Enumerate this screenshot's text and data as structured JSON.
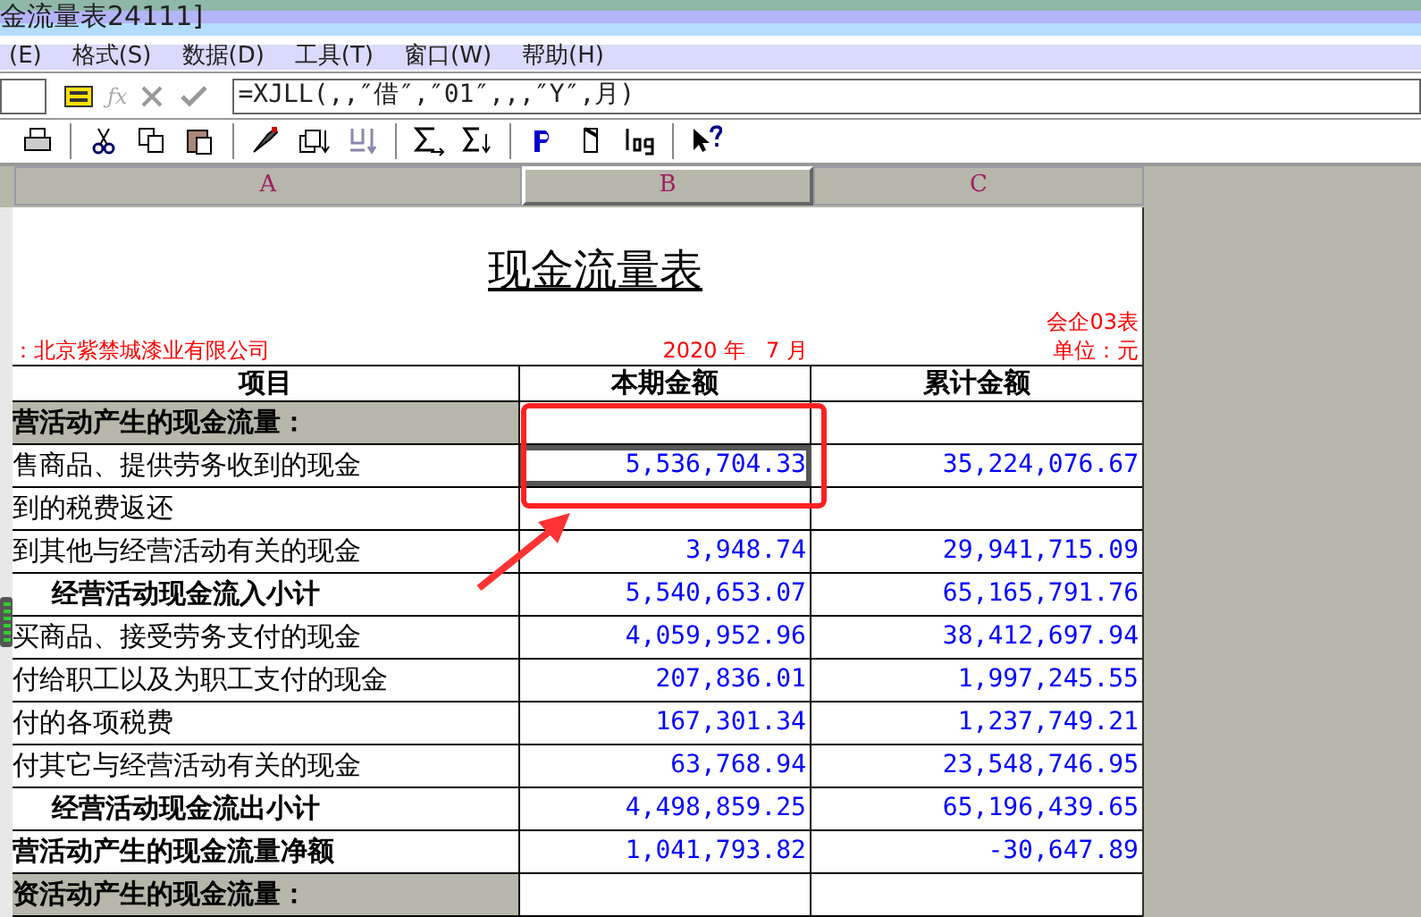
{
  "window": {
    "title": "金流量表24111]"
  },
  "menu": [
    "(E)",
    "格式(S)",
    "数据(D)",
    "工具(T)",
    "窗口(W)",
    "帮助(H)"
  ],
  "formula_bar": {
    "function_label": "ƒx",
    "formula": "=XJLL(,,″借″,″01″,,,″Y″,月)"
  },
  "columns": [
    {
      "label": "A",
      "selected": false
    },
    {
      "label": "B",
      "selected": true
    },
    {
      "label": "C",
      "selected": false
    }
  ],
  "sheet": {
    "title": "现金流量表",
    "form_code": "会企03表",
    "company": "：北京紫禁城漆业有限公司",
    "period": "2020 年   7 月",
    "unit": "单位：元",
    "headers": [
      "项目",
      "本期金额",
      "累计金额"
    ],
    "rows": [
      {
        "kind": "section",
        "label": "营活动产生的现金流量：",
        "selected": false
      },
      {
        "kind": "item",
        "label": "售商品、提供劳务收到的现金",
        "current": "5,536,704.33",
        "cumulative": "35,224,076.67",
        "selected": true
      },
      {
        "kind": "item",
        "label": "到的税费返还",
        "selected": false
      },
      {
        "kind": "item",
        "label": "到其他与经营活动有关的现金",
        "current": "3,948.74",
        "cumulative": "29,941,715.09",
        "selected": false
      },
      {
        "kind": "subtotal",
        "label": "经营活动现金流入小计",
        "current": "5,540,653.07",
        "cumulative": "65,165,791.76",
        "selected": false
      },
      {
        "kind": "item",
        "label": "买商品、接受劳务支付的现金",
        "current": "4,059,952.96",
        "cumulative": "38,412,697.94",
        "selected": false
      },
      {
        "kind": "item",
        "label": "付给职工以及为职工支付的现金",
        "current": "207,836.01",
        "cumulative": "1,997,245.55",
        "selected": false
      },
      {
        "kind": "item",
        "label": "付的各项税费",
        "current": "167,301.34",
        "cumulative": "1,237,749.21",
        "selected": false
      },
      {
        "kind": "item",
        "label": "付其它与经营活动有关的现金",
        "current": "63,768.94",
        "cumulative": "23,548,746.95",
        "selected": false
      },
      {
        "kind": "subtotal",
        "label": "经营活动现金流出小计",
        "current": "4,498,859.25",
        "cumulative": "65,196,439.65",
        "selected": false
      },
      {
        "kind": "total",
        "label": "营活动产生的现金流量净额",
        "current": "1,041,793.82",
        "cumulative": "-30,647.89",
        "selected": false
      },
      {
        "kind": "section",
        "label": "资活动产生的现金流量：",
        "selected": false
      }
    ]
  }
}
